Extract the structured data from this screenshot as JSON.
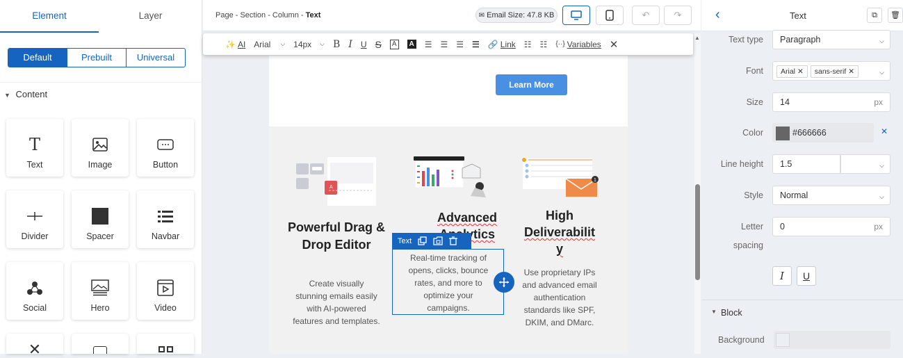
{
  "left_panel": {
    "tabs": [
      "Element",
      "Layer"
    ],
    "segments": [
      "Default",
      "Prebuilt",
      "Universal"
    ],
    "section": "Content",
    "tiles": [
      "Text",
      "Image",
      "Button",
      "Divider",
      "Spacer",
      "Navbar",
      "Social",
      "Hero",
      "Video"
    ]
  },
  "topbar": {
    "breadcrumb": "Page - Section - Column - ",
    "breadcrumb_current": "Text",
    "email_size": "Email Size: 47.8 KB"
  },
  "format_toolbar": {
    "ai": "AI",
    "font": "Arial",
    "size": "14px",
    "link": "Link",
    "variables": "Variables"
  },
  "canvas": {
    "learn_more": "Learn More",
    "col1_title": "Powerful Drag & Drop Editor",
    "col1_text": "Create visually stunning emails easily with AI-powered features and templates.",
    "col2_title_1": "Advanced",
    "col2_title_2": "Analytics",
    "col2_text": "Real-time tracking of opens, clicks, bounce rates, and more to optimize your campaigns.",
    "col3_title_1": "High",
    "col3_title_2": "Deliverabilit",
    "col3_title_3": "y",
    "col3_text": "Use proprietary IPs and advanced email authentication standards like SPF, DKIM, and DMarc.",
    "selection_label": "Text"
  },
  "right_panel": {
    "title": "Text",
    "text_type_label": "Text type",
    "text_type": "Paragraph",
    "font_label": "Font",
    "font_chips": [
      "Arial",
      "sans-serif"
    ],
    "size_label": "Size",
    "size": "14",
    "unit": "px",
    "color_label": "Color",
    "color": "#666666",
    "line_height_label": "Line height",
    "line_height": "1.5",
    "style_label": "Style",
    "style": "Normal",
    "letter_label_1": "Letter",
    "letter_label_2": "spacing",
    "letter": "0",
    "block_label": "Block",
    "background_label": "Background"
  },
  "colors": {
    "accent": "#1565c0",
    "button": "#4a90e2",
    "text_color": "#666666"
  }
}
